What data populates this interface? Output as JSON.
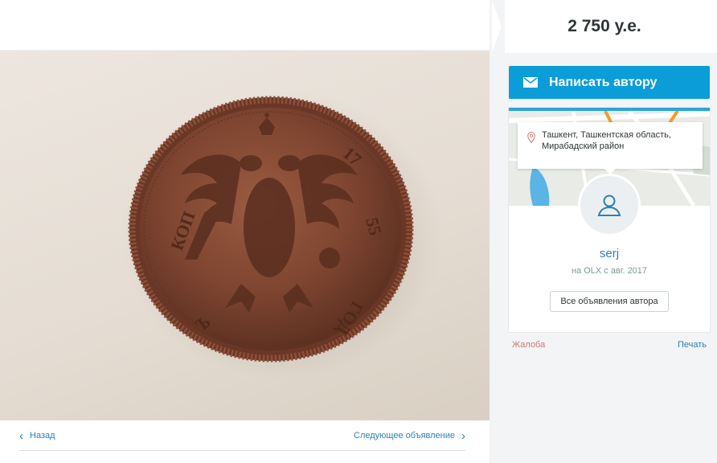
{
  "listing": {
    "price": "2 750 у.е.",
    "write_button_label": "Написать автору"
  },
  "gallery": {
    "photo_alt": "Медная монета",
    "prev_label": "Назад",
    "next_label": "Следующее объявление"
  },
  "author": {
    "location": "Ташкент, Ташкентская область, Мирабадский район",
    "name": "serj",
    "since": "на OLX с авг. 2017",
    "all_ads_label": "Все объявления автора"
  },
  "footer_links": {
    "complaint": "Жалоба",
    "print": "Печать"
  },
  "colors": {
    "accent": "#0b9dd8",
    "link": "#2d7fb6",
    "complaint": "#d1766a"
  },
  "icons": {
    "envelope": "envelope-icon",
    "location": "map-pin-icon",
    "user": "user-icon",
    "prev": "chevron-left-icon",
    "next": "chevron-right-icon"
  }
}
